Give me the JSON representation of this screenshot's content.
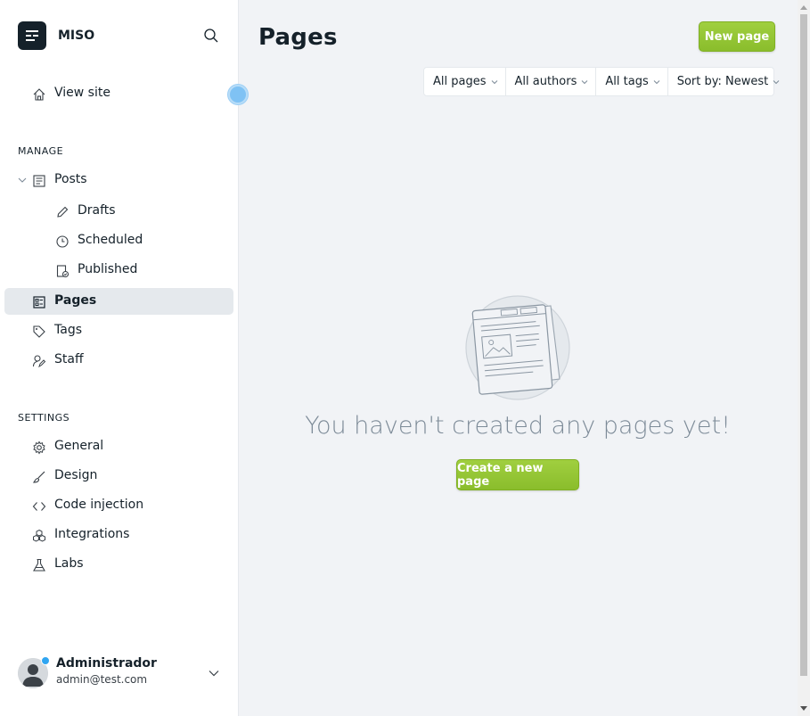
{
  "brand": {
    "name": "MISO"
  },
  "sidebar": {
    "view_site": "View site",
    "manage_title": "MANAGE",
    "posts": "Posts",
    "drafts": "Drafts",
    "scheduled": "Scheduled",
    "published": "Published",
    "pages": "Pages",
    "tags": "Tags",
    "staff": "Staff",
    "settings_title": "SETTINGS",
    "general": "General",
    "design": "Design",
    "code_injection": "Code injection",
    "integrations": "Integrations",
    "labs": "Labs"
  },
  "user": {
    "name": "Administrador",
    "email": "admin@test.com"
  },
  "main": {
    "title": "Pages",
    "new_page": "New page",
    "filters": [
      "All pages",
      "All authors",
      "All tags",
      "Sort by: Newest"
    ],
    "empty_message": "You haven't created any pages yet!",
    "create_button": "Create a new page"
  },
  "colors": {
    "accent": "#9fcd3e",
    "active_bg": "#e5e9ed",
    "status": "#30a5f1"
  }
}
